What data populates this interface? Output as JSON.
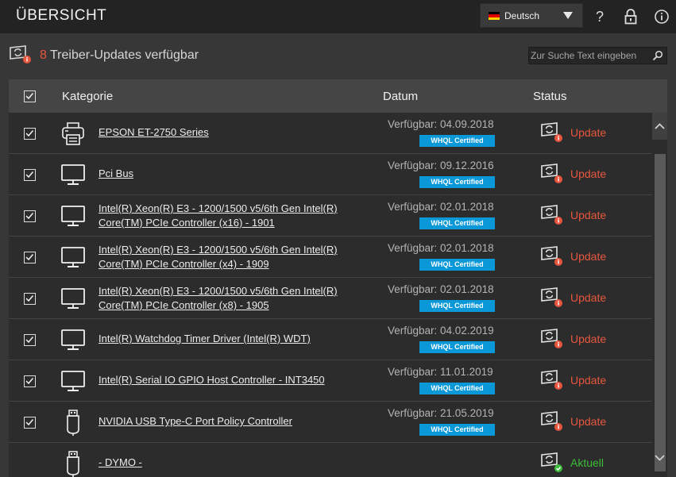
{
  "header": {
    "title": "ÜBERSICHT",
    "language": "Deutsch",
    "flag_colors": [
      "#000000",
      "#dd0000",
      "#ffce00"
    ]
  },
  "subbar": {
    "update_count": "8",
    "update_text": "Treiber-Updates verfügbar",
    "search_placeholder": "Zur Suche Text eingeben"
  },
  "table": {
    "columns": {
      "category": "Kategorie",
      "date": "Datum",
      "status": "Status"
    },
    "rows": [
      {
        "checked": true,
        "icon": "printer-icon",
        "lines": [
          "EPSON ET-2750 Series"
        ],
        "available": "Verfügbar: 04.09.2018",
        "badge": "WHQL Certified",
        "status": "Update",
        "status_type": "update"
      },
      {
        "checked": true,
        "icon": "monitor-icon",
        "lines": [
          "Pci Bus"
        ],
        "available": "Verfügbar: 09.12.2016",
        "badge": "WHQL Certified",
        "status": "Update",
        "status_type": "update"
      },
      {
        "checked": true,
        "icon": "monitor-icon",
        "lines": [
          "Intel(R) Xeon(R) E3 - 1200/1500 v5/6th Gen Intel(R)",
          "Core(TM) PCIe Controller (x16) - 1901"
        ],
        "available": "Verfügbar: 02.01.2018",
        "badge": "WHQL Certified",
        "status": "Update",
        "status_type": "update"
      },
      {
        "checked": true,
        "icon": "monitor-icon",
        "lines": [
          "Intel(R) Xeon(R) E3 - 1200/1500 v5/6th Gen Intel(R)",
          "Core(TM) PCIe Controller (x4) - 1909"
        ],
        "available": "Verfügbar: 02.01.2018",
        "badge": "WHQL Certified",
        "status": "Update",
        "status_type": "update"
      },
      {
        "checked": true,
        "icon": "monitor-icon",
        "lines": [
          "Intel(R) Xeon(R) E3 - 1200/1500 v5/6th Gen Intel(R)",
          "Core(TM) PCIe Controller (x8) - 1905"
        ],
        "available": "Verfügbar: 02.01.2018",
        "badge": "WHQL Certified",
        "status": "Update",
        "status_type": "update"
      },
      {
        "checked": true,
        "icon": "monitor-icon",
        "lines": [
          "Intel(R) Watchdog Timer Driver (Intel(R) WDT)"
        ],
        "available": "Verfügbar: 04.02.2019",
        "badge": "WHQL Certified",
        "status": "Update",
        "status_type": "update"
      },
      {
        "checked": true,
        "icon": "monitor-icon",
        "lines": [
          "Intel(R) Serial IO GPIO Host Controller - INT3450"
        ],
        "available": "Verfügbar: 11.01.2019",
        "badge": "WHQL Certified",
        "status": "Update",
        "status_type": "update"
      },
      {
        "checked": true,
        "icon": "usb-icon",
        "lines": [
          "NVIDIA USB Type-C Port Policy Controller"
        ],
        "available": "Verfügbar: 21.05.2019",
        "badge": "WHQL Certified",
        "status": "Update",
        "status_type": "update"
      },
      {
        "checked": false,
        "icon": "usb-icon",
        "lines": [
          "- DYMO -"
        ],
        "available": "",
        "badge": "",
        "status": "Aktuell",
        "status_type": "ok"
      }
    ]
  },
  "colors": {
    "accent": "#e8563e",
    "ok": "#3dbb3a",
    "whql": "#0a98d8"
  }
}
